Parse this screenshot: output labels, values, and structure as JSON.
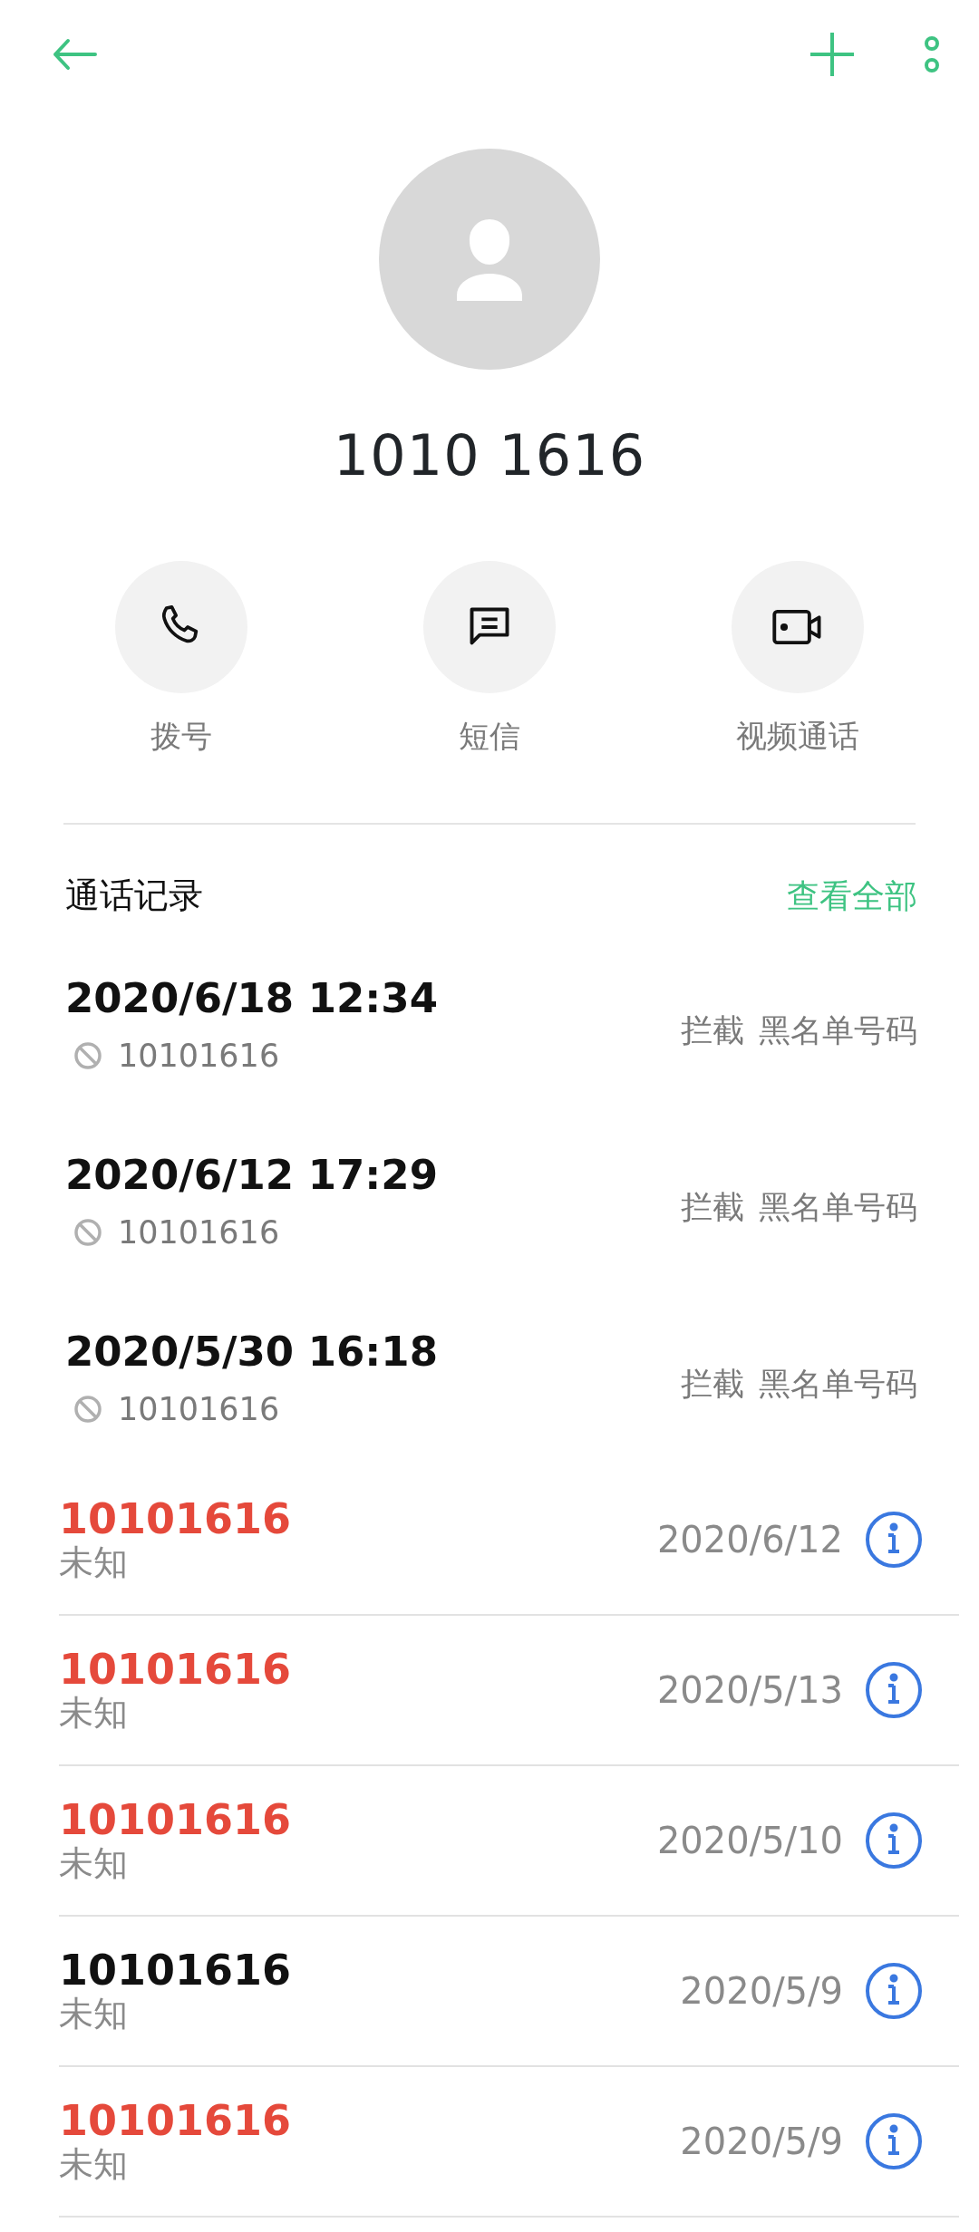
{
  "contact": {
    "name": "1010 1616"
  },
  "actions": [
    {
      "kind": "call",
      "label": "拨号"
    },
    {
      "kind": "message",
      "label": "短信"
    },
    {
      "kind": "video",
      "label": "视频通话"
    }
  ],
  "call_log": {
    "title": "通话记录",
    "view_all": "查看全部",
    "entries": [
      {
        "time": "2020/6/18 12:34",
        "number": "10101616",
        "status": "拦截",
        "reason": "黑名单号码"
      },
      {
        "time": "2020/6/12 17:29",
        "number": "10101616",
        "status": "拦截",
        "reason": "黑名单号码"
      },
      {
        "time": "2020/5/30 16:18",
        "number": "10101616",
        "status": "拦截",
        "reason": "黑名单号码"
      }
    ]
  },
  "recent_calls": [
    {
      "number": "10101616",
      "location": "未知",
      "date": "2020/6/12",
      "missed": true
    },
    {
      "number": "10101616",
      "location": "未知",
      "date": "2020/5/13",
      "missed": true
    },
    {
      "number": "10101616",
      "location": "未知",
      "date": "2020/5/10",
      "missed": true
    },
    {
      "number": "10101616",
      "location": "未知",
      "date": "2020/5/9",
      "missed": false
    },
    {
      "number": "10101616",
      "location": "未知",
      "date": "2020/5/9",
      "missed": true
    }
  ]
}
